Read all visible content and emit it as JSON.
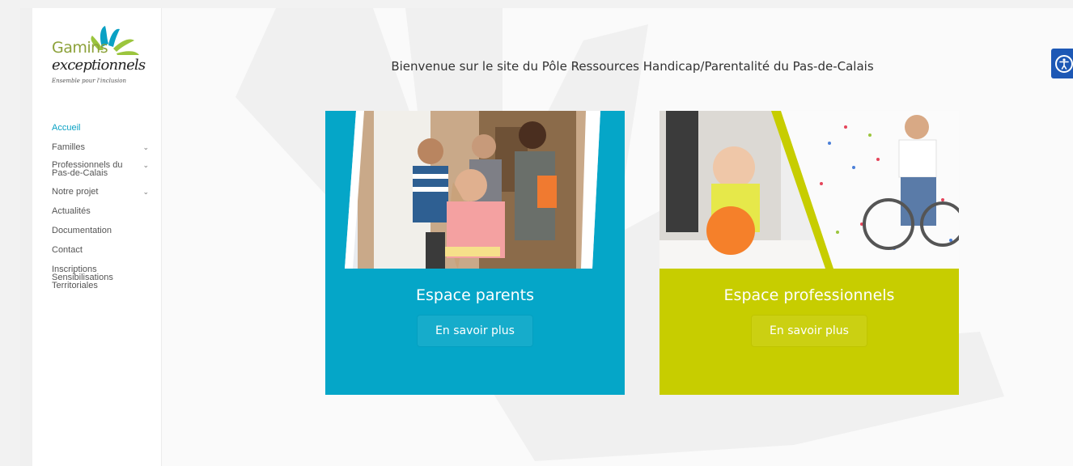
{
  "logo": {
    "line1": "Gamins",
    "line2": "exceptionnels",
    "line3": "Ensemble pour l'inclusion"
  },
  "nav": {
    "items": [
      {
        "label": "Accueil",
        "active": true,
        "has_children": false
      },
      {
        "label": "Familles",
        "active": false,
        "has_children": true
      },
      {
        "label": "Professionnels du Pas-de-Calais",
        "active": false,
        "has_children": true
      },
      {
        "label": "Notre projet",
        "active": false,
        "has_children": true
      },
      {
        "label": "Actualités",
        "active": false,
        "has_children": false
      },
      {
        "label": "Documentation",
        "active": false,
        "has_children": false
      },
      {
        "label": "Contact",
        "active": false,
        "has_children": false
      },
      {
        "label": "Inscriptions Sensibilisations Territoriales",
        "active": false,
        "has_children": false
      }
    ]
  },
  "main": {
    "welcome": "Bienvenue sur le site du Pôle Ressources Handicap/Parentalité du Pas-de-Calais",
    "cards": [
      {
        "title": "Espace parents",
        "button": "En savoir plus",
        "color": "#05a6c8"
      },
      {
        "title": "Espace professionnels",
        "button": "En savoir plus",
        "color": "#c7cd00"
      }
    ]
  },
  "colors": {
    "accent": "#0aa1c4",
    "parents": "#05a6c8",
    "professionals": "#c7cd00",
    "a11y": "#1d58b5"
  },
  "icons": {
    "accessibility": "accessibility-icon",
    "chevron": "chevron-down-icon"
  }
}
